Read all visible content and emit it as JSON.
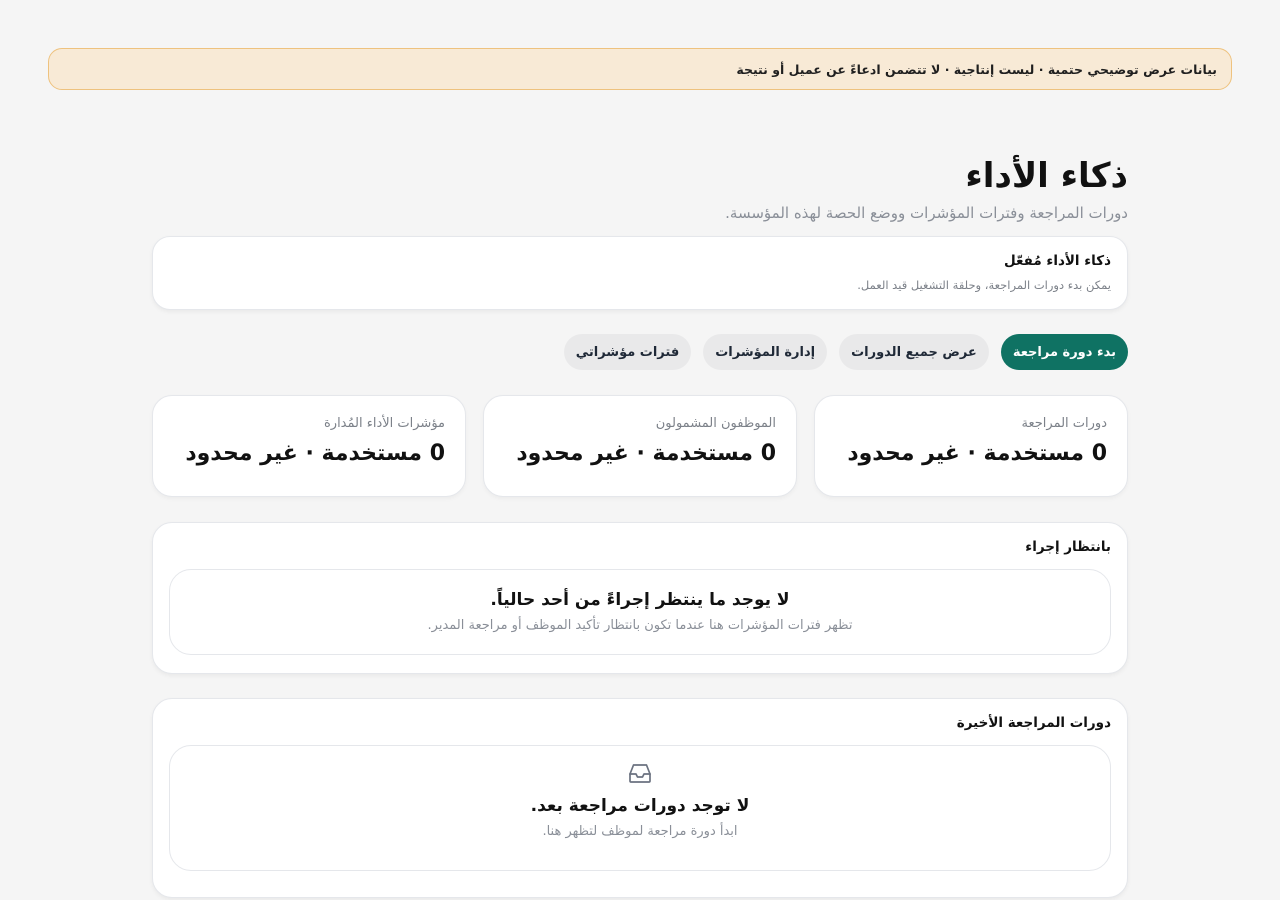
{
  "banner": {
    "text": "بيانات عرض توضيحي حتمية · ليست إنتاجية · لا تتضمن ادعاءً عن عميل أو نتيجة"
  },
  "header": {
    "title": "ذكاء الأداء",
    "subtitle": "دورات المراجعة وفترات المؤشرات ووضع الحصة لهذه المؤسسة."
  },
  "status": {
    "title": "ذكاء الأداء مُفعّل",
    "description": "يمكن بدء دورات المراجعة، وحلقة التشغيل قيد العمل."
  },
  "actions": {
    "start_cycle": "بدء دورة مراجعة",
    "view_cycles": "عرض جميع الدورات",
    "manage_indicators": "إدارة المؤشرات",
    "my_periods": "فترات مؤشراتي"
  },
  "stats": [
    {
      "label": "دورات المراجعة",
      "value": "0 مستخدمة · غير محدود"
    },
    {
      "label": "الموظفون المشمولون",
      "value": "0 مستخدمة · غير محدود"
    },
    {
      "label": "مؤشرات الأداء المُدارة",
      "value": "0 مستخدمة · غير محدود"
    }
  ],
  "pending": {
    "title": "بانتظار إجراء",
    "empty_title": "لا يوجد ما ينتظر إجراءً من أحد حالياً.",
    "empty_desc": "تظهر فترات المؤشرات هنا عندما تكون بانتظار تأكيد الموظف أو مراجعة المدير."
  },
  "recent": {
    "title": "دورات المراجعة الأخيرة",
    "icon": "inbox-icon",
    "empty_title": "لا توجد دورات مراجعة بعد.",
    "empty_desc": "ابدأ دورة مراجعة لموظف لتظهر هنا."
  },
  "colors": {
    "accent": "#0f7263",
    "banner_bg": "#f8ead6",
    "banner_border": "#eec27e",
    "background": "#f5f5f5"
  }
}
